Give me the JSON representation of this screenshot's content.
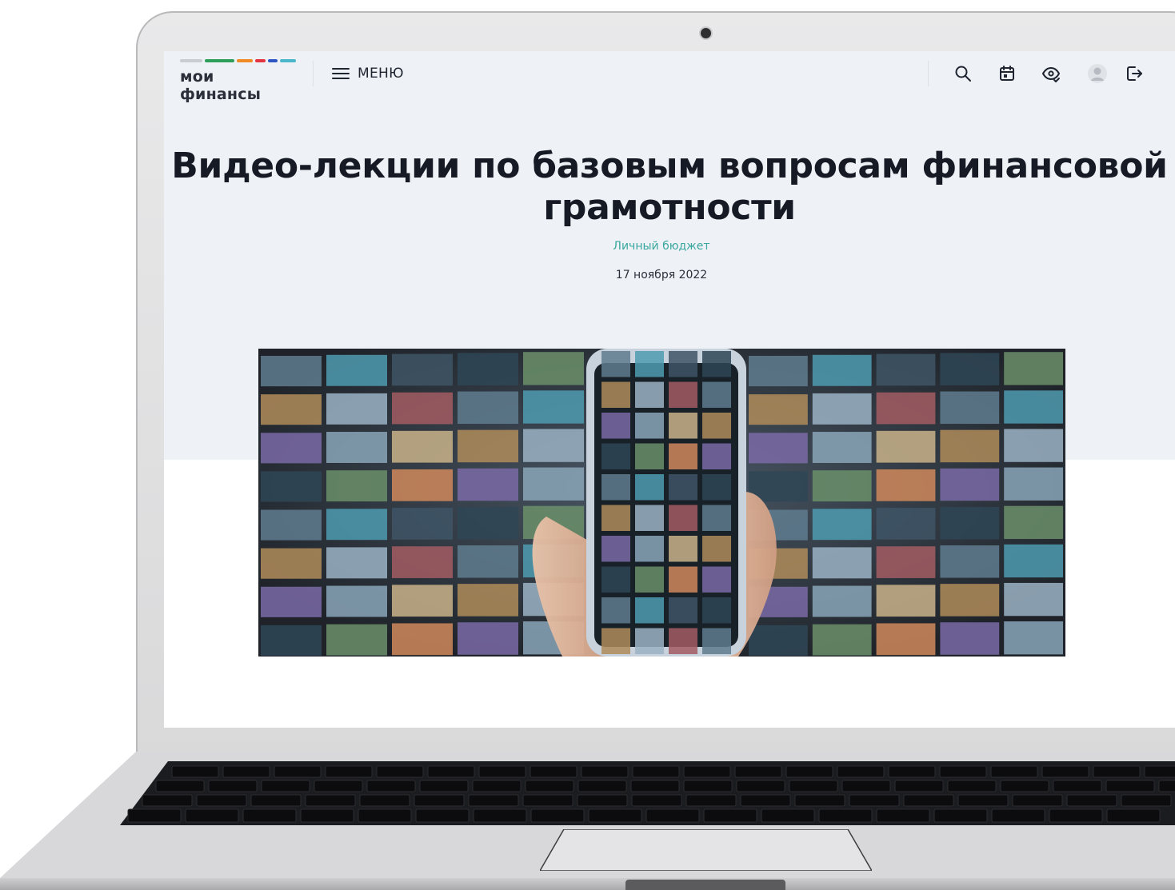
{
  "site": {
    "logo_text": "мои финансы",
    "logo_colors": [
      "#c9ccd0",
      "#2e9e5b",
      "#f08a24",
      "#e3343f",
      "#2f57c4",
      "#49b7c9"
    ],
    "menu_label": "МЕНЮ",
    "header_icons": [
      "search-icon",
      "calendar-icon",
      "accessibility-eye-icon",
      "avatar",
      "logout-icon"
    ]
  },
  "article": {
    "title_line1": "Видео-лекции по базовым вопросам финансовой",
    "title_line2": "грамотности",
    "category": "Личный бюджет",
    "date": "17 ноября 2022"
  },
  "colors": {
    "hero_background": "#eef2f6",
    "category_accent": "#3aa79e",
    "title_text": "#151a24"
  }
}
